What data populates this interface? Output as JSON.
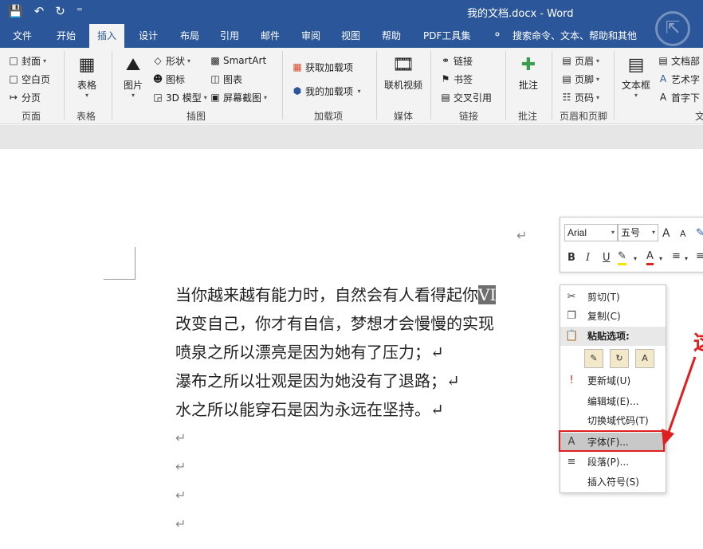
{
  "titlebar": {
    "quick_access": {
      "save": "💾",
      "undo": "↶",
      "redo": "↻",
      "more": "⁼"
    },
    "title": "我的文档.docx  -  Word"
  },
  "tabs": [
    "文件",
    "开始",
    "插入",
    "设计",
    "布局",
    "引用",
    "邮件",
    "审阅",
    "视图",
    "帮助",
    "PDF工具集"
  ],
  "active_tab": "插入",
  "search_hint": "搜索命令、文本、帮助和其他",
  "ribbon": {
    "pages": {
      "cover": "封面",
      "blank": "空白页",
      "break": "分页",
      "label": "页面"
    },
    "tables": {
      "table": "表格",
      "label": "表格"
    },
    "illustrations": {
      "picture": "图片",
      "shapes": "形状",
      "icons": "图标",
      "model3d": "3D 模型",
      "smartart": "SmartArt",
      "chart": "图表",
      "screenshot": "屏幕截图",
      "label": "插图"
    },
    "addins": {
      "get": "获取加载项",
      "mine": "我的加载项",
      "label": "加载项"
    },
    "media": {
      "video": "联机视频",
      "label": "媒体"
    },
    "links": {
      "link": "链接",
      "bookmark": "书签",
      "crossref": "交叉引用",
      "label": "链接"
    },
    "comments": {
      "comment": "批注",
      "label": "批注"
    },
    "header_footer": {
      "header": "页眉",
      "footer": "页脚",
      "page_number": "页码",
      "label": "页眉和页脚"
    },
    "text": {
      "textbox": "文本框",
      "docpart": "文档部",
      "wordart": "艺术字",
      "dropcap": "首字下",
      "label": "文"
    }
  },
  "document": {
    "lines": [
      "当你越来越有能力时，自然会有人看得起你",
      "改变自己，你才有自信，梦想才会慢慢的实现",
      "喷泉之所以漂亮是因为她有了压力；↵",
      "瀑布之所以壮观是因为她没有了退路；↵",
      "水之所以能穿石是因为永远在坚持。↵"
    ],
    "selected_text": "VI",
    "para_mark": "↵"
  },
  "mini_toolbar": {
    "font": "Arial",
    "size": "五号",
    "grow": "A",
    "shrink": "A",
    "bold": "B",
    "italic": "I",
    "underline": "U"
  },
  "context_menu": {
    "cut": "剪切(T)",
    "copy": "复制(C)",
    "paste_options": "粘贴选项:",
    "update_field": "更新域(U)",
    "edit_field": "编辑域(E)...",
    "toggle_codes": "切换域代码(T)",
    "font": "字体(F)...",
    "paragraph": "段落(P)...",
    "insert_symbol": "插入符号(S)"
  },
  "annotation": {
    "char": "这",
    "color": "#e02020"
  },
  "colors": {
    "brand": "#2b579a",
    "ribbon": "#f3f3f3",
    "highlight": "#c8c8c8"
  }
}
